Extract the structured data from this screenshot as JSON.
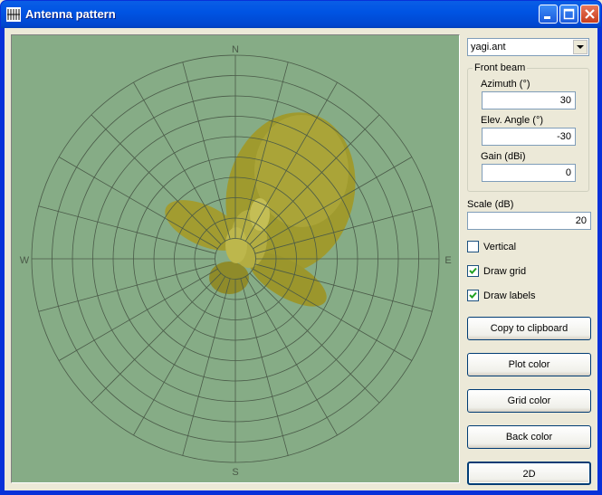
{
  "window": {
    "title": "Antenna pattern"
  },
  "plot": {
    "compass": {
      "north": "N",
      "east": "E",
      "south": "S",
      "west": "W"
    },
    "colors": {
      "background": "#86ac86",
      "grid": "#4a5a48",
      "pattern": "#a8a02c"
    }
  },
  "file_select": {
    "value": "yagi.ant"
  },
  "front_beam": {
    "label": "Front beam",
    "azimuth_label": "Azimuth (°)",
    "azimuth_value": "30",
    "elevation_label": "Elev. Angle (°)",
    "elevation_value": "-30",
    "gain_label": "Gain (dBi)",
    "gain_value": "0"
  },
  "scale": {
    "label": "Scale (dB)",
    "value": "20"
  },
  "options": {
    "vertical": {
      "label": "Vertical",
      "checked": false
    },
    "draw_grid": {
      "label": "Draw grid",
      "checked": true
    },
    "draw_labels": {
      "label": "Draw labels",
      "checked": true
    }
  },
  "buttons": {
    "copy": "Copy to clipboard",
    "plot_color": "Plot color",
    "grid_color": "Grid color",
    "back_color": "Back color",
    "mode": "2D"
  }
}
